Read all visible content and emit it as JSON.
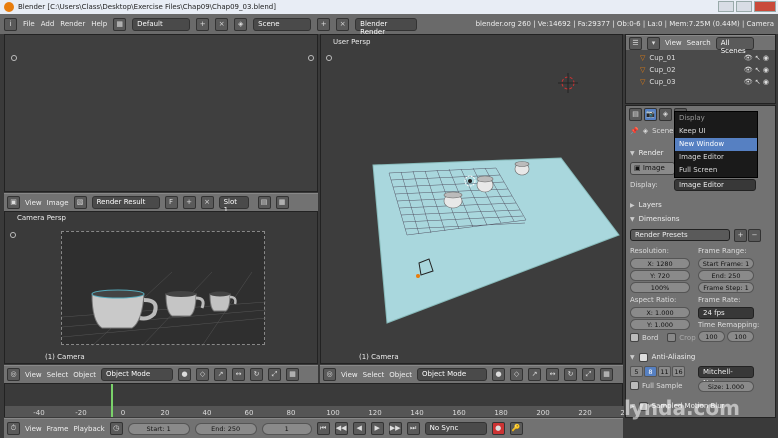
{
  "window": {
    "title": "Blender [C:\\Users\\Class\\Desktop\\Exercise Files\\Chap09\\Chap09_03.blend]"
  },
  "infobar": {
    "menus": [
      "File",
      "Add",
      "Render",
      "Help"
    ],
    "screen_layout": "Default",
    "scene": "Scene",
    "render_engine": "Blender Render",
    "stats": "blender.org 260 | Ve:14692 | Fa:29377 | Ob:0-6 | La:0 | Mem:7.25M (0.44M) | Camera"
  },
  "image_editor": {
    "menus": [
      "View",
      "Image"
    ],
    "image_name": "Render Result",
    "image_field_suffix": "F",
    "slot": "Slot 1"
  },
  "camera_view": {
    "label": "Camera Persp",
    "object_label": "(1) Camera"
  },
  "bottom_left_header": {
    "menus": [
      "View",
      "Select",
      "Object"
    ],
    "mode": "Object Mode"
  },
  "viewport": {
    "label": "User Persp",
    "object_label": "(1) Camera"
  },
  "viewport_header": {
    "menus": [
      "View",
      "Select",
      "Object"
    ],
    "mode": "Object Mode"
  },
  "outliner": {
    "menus": [
      "View",
      "Search"
    ],
    "filter": "All Scenes",
    "items": [
      "Cup_01",
      "Cup_02",
      "Cup_03"
    ]
  },
  "popup_menu": {
    "title": "Display",
    "items": [
      "Keep UI",
      "New Window",
      "Image Editor",
      "Full Screen"
    ],
    "selected_index": 1
  },
  "properties": {
    "context": "Scene",
    "render_panel": "Render",
    "image_btn": "Image",
    "display_label": "Display:",
    "display_value": "Image Editor",
    "layers": "Layers",
    "dimensions": "Dimensions",
    "render_presets": "Render Presets",
    "resolution_label": "Resolution:",
    "res_x": "X: 1280",
    "res_y": "Y: 720",
    "res_pct": "100%",
    "frame_range_label": "Frame Range:",
    "start_frame": "Start Frame: 1",
    "end_frame": "End: 250",
    "frame_step": "Frame Step: 1",
    "aspect_label": "Aspect Ratio:",
    "aspect_x": "X: 1.000",
    "aspect_y": "Y: 1.000",
    "frame_rate_label": "Frame Rate:",
    "fps": "24 fps",
    "time_remap_label": "Time Remapping:",
    "remap_old": "100",
    "remap_new": "100",
    "bord": "Bord",
    "crop": "Crop",
    "anti_aliasing": "Anti-Aliasing",
    "aa_samples": [
      "5",
      "8",
      "11",
      "16"
    ],
    "aa_selected": 1,
    "aa_filter": "Mitchell-Netrav",
    "full_sample": "Full Sample",
    "aa_size": "Size: 1.000",
    "motion_blur": "Sampled Motion Blur"
  },
  "timeline": {
    "ruler_ticks": [
      "-40",
      "-20",
      "0",
      "20",
      "40",
      "60",
      "80",
      "100",
      "120",
      "140",
      "160",
      "180",
      "200",
      "220",
      "240",
      "260"
    ],
    "menus": [
      "View",
      "Frame",
      "Playback"
    ],
    "start": "Start: 1",
    "end": "End: 250",
    "current": "1",
    "sync": "No Sync"
  },
  "watermark": {
    "text": "lynda.com"
  },
  "colors": {
    "floor": "#a9d7dd",
    "selected": "#5680c2",
    "frame_line": "#7ad16a",
    "orange": "#e87d0d"
  }
}
